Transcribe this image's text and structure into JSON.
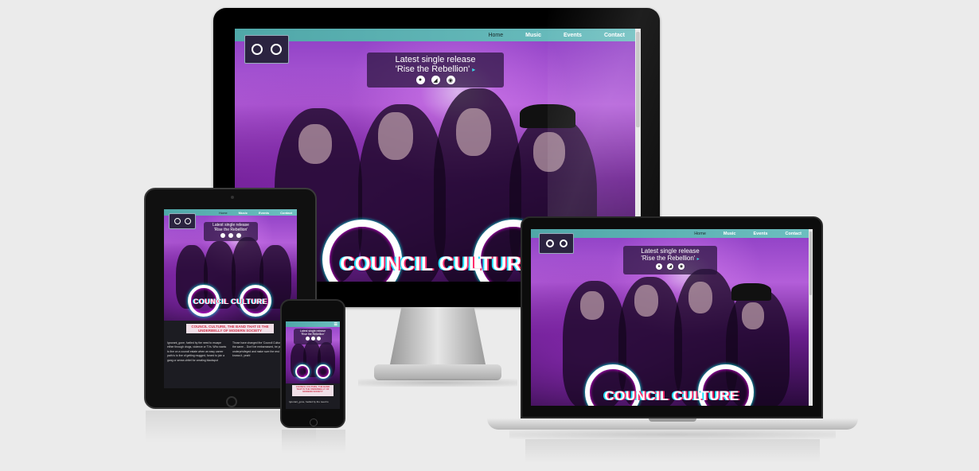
{
  "site": {
    "nav": [
      "Home",
      "Music",
      "Events",
      "Contact"
    ],
    "logo_text": "COUNCIL CULTURE",
    "release_line1": "Latest single release",
    "release_line2": "'Rise the Rebellion'",
    "release_arrow": "▸",
    "brand_title": "COUNCIL CULTURE",
    "tagline": "COUNCIL CULTURE, THE BAND THAT IS THE UNDERBELLY OF MODERN SOCIETY",
    "body_col1": "Ignorant_gone, fuelled by the need to escape either through drugs, violence or TVs. Who wants to live on a council estate when an easy career path is to live of getting mugged, forced to join a gang or sense-chttel for creating blackspot",
    "body_col2": "Those have changed the 'Council Culture' mess to the same... Don't be embarrassed, be proud of your underprivileged and make sure the rest of the world knows it, yeah!",
    "phone_body": "Ignorant_gone, fuelled by the need to"
  },
  "icons": [
    "spotify-icon",
    "soundcloud-icon",
    "apple-music-icon"
  ],
  "colors": {
    "navbar": "#5fb4b5",
    "accent_red": "#d0344c",
    "background": "#ebebeb"
  }
}
